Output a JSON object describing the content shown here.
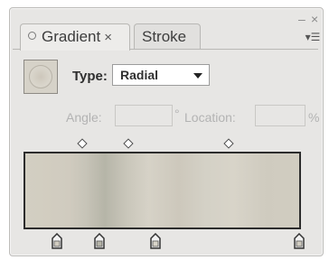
{
  "window_controls": {
    "minimize": "–",
    "close": "×"
  },
  "tabs": [
    {
      "label": "Gradient",
      "close": "×"
    },
    {
      "label": "Stroke"
    }
  ],
  "menu_icon": "menu-icon",
  "gradient": {
    "type_label": "Type:",
    "type_value": "Radial",
    "angle_label": "Angle:",
    "angle_unit": "°",
    "location_label": "Location:",
    "location_unit": "%",
    "stops_count": 4,
    "midpoints_count": 3
  },
  "colors": {
    "panel_bg": "#e7e6e4",
    "gradient_light": "#d3cfc2",
    "gradient_dark": "#b6b5a8"
  }
}
